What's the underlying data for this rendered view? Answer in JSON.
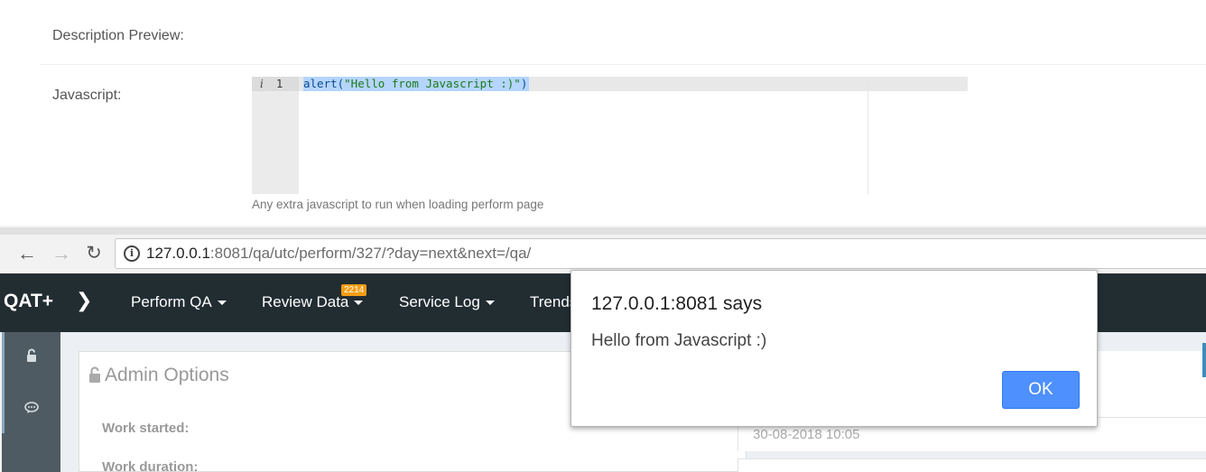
{
  "form": {
    "description_preview_label": "Description Preview:",
    "javascript_label": "Javascript:",
    "editor": {
      "gutter_info": "i",
      "line_number": "1",
      "code_func": "alert(",
      "code_string": "\"Hello from Javascript :)\"",
      "code_end": ")"
    },
    "help_text": "Any extra javascript to run when loading perform page"
  },
  "browser": {
    "url_host": "127.0.0.1",
    "url_rest": ":8081/qa/utc/perform/327/?day=next&next=/qa/"
  },
  "navbar": {
    "brand": "QAT+",
    "menu": [
      {
        "label": "Perform QA"
      },
      {
        "label": "Review Data",
        "badge": "2214"
      },
      {
        "label": "Service Log"
      },
      {
        "label": "Trends"
      }
    ]
  },
  "panel": {
    "title": "Admin Options",
    "work_started_label": "Work started:",
    "work_duration_label": "Work duration:",
    "work_started_value": "30-08-2018 10:05"
  },
  "dialog": {
    "title": "127.0.0.1:8081 says",
    "message": "Hello from Javascript :)",
    "ok_label": "OK"
  },
  "colors": {
    "navbar_bg": "#222d32",
    "sidebar_bg": "#4f5b62",
    "badge": "#f39c12",
    "ok_button": "#4d90fe"
  }
}
